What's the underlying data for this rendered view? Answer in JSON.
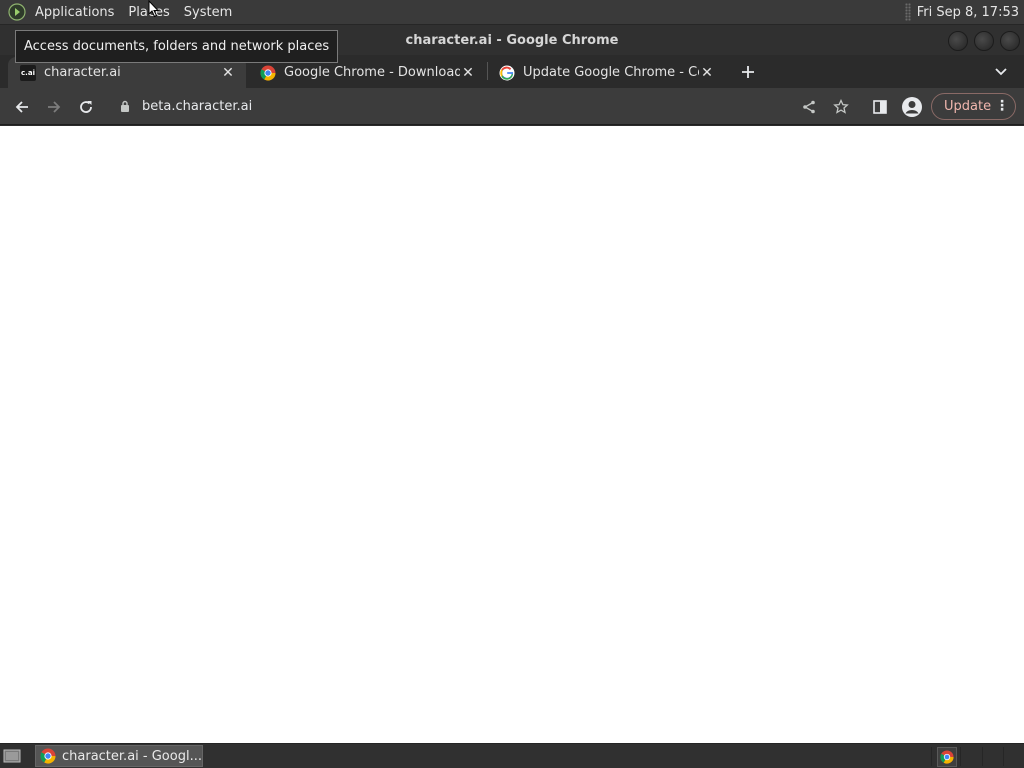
{
  "top_panel": {
    "menus": [
      "Applications",
      "Places",
      "System"
    ],
    "clock": "Fri Sep  8, 17:53"
  },
  "tooltip": "Access documents, folders and network places",
  "window": {
    "title": "character.ai - Google Chrome"
  },
  "tabs": [
    {
      "title": "character.ai",
      "favicon": "c.ai",
      "active": true
    },
    {
      "title": "Google Chrome - Download th",
      "favicon": "chrome-icon",
      "active": false
    },
    {
      "title": "Update Google Chrome - Com",
      "favicon": "google-icon",
      "active": false
    }
  ],
  "toolbar": {
    "url": "beta.character.ai",
    "update_label": "Update"
  },
  "taskbar": {
    "task_label": "character.ai - Googl..."
  },
  "colors": {
    "update_accent": "#f0b6ae",
    "page_background": "#ffffff"
  }
}
